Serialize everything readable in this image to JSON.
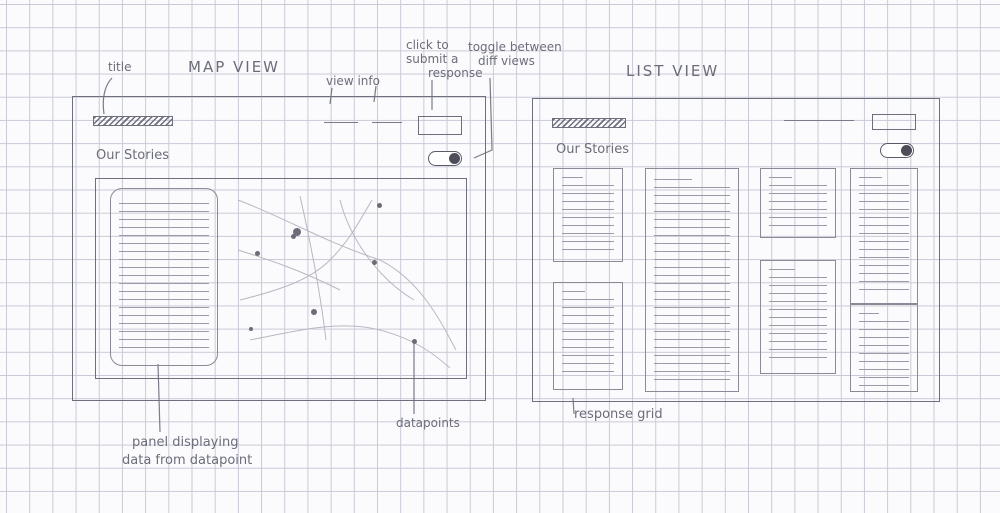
{
  "map_view": {
    "heading": "MAP VIEW",
    "stories_label": "Our Stories",
    "ann_title": "title",
    "ann_view_info": "view info",
    "ann_click_submit": [
      "click to",
      "submit a",
      "response"
    ],
    "ann_toggle": [
      "toggle between",
      "diff views"
    ],
    "ann_panel": [
      "panel displaying",
      "data from datapoint"
    ],
    "ann_datapoints": "datapoints"
  },
  "list_view": {
    "heading": "LIST VIEW",
    "stories_label": "Our Stories",
    "ann_grid": "response grid"
  }
}
